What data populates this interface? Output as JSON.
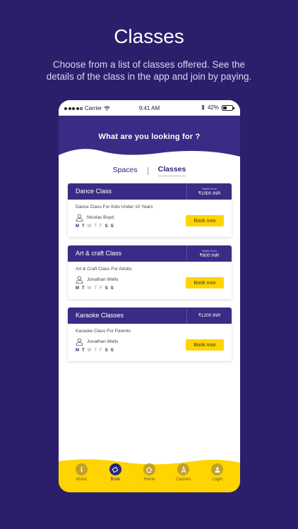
{
  "promo": {
    "title": "Classes",
    "subtitle": "Choose from a list of classes offered. See the details of the class in the app and join by paying."
  },
  "status_bar": {
    "carrier": "Carrier",
    "time": "9:41 AM",
    "battery": "42%"
  },
  "header": {
    "title": "What are you looking for ?"
  },
  "tabs": [
    {
      "label": "Spaces",
      "active": false
    },
    {
      "label": "Classes",
      "active": true
    }
  ],
  "classes": [
    {
      "title": "Dance Class",
      "price_label": "Starts From",
      "price": "₹1000 INR",
      "description": "Dance Class For Kids Under 10 Years",
      "teacher": "Nicolas Boyd",
      "days": [
        "M",
        "T",
        "W",
        "T",
        "F",
        "S",
        "S"
      ],
      "days_on": [
        true,
        true,
        false,
        false,
        false,
        true,
        true
      ],
      "book_label": "Book now"
    },
    {
      "title": "Art & craft Class",
      "price_label": "Starts From",
      "price": "₹800 INR",
      "description": "Art & Craft Class For Adults",
      "teacher": "Jonathan Wells",
      "days": [
        "M",
        "T",
        "W",
        "T",
        "F",
        "S",
        "S"
      ],
      "days_on": [
        true,
        true,
        false,
        false,
        false,
        true,
        true
      ],
      "book_label": "Book now"
    },
    {
      "title": "Karaoke Classes",
      "price_label": "",
      "price": "₹1200 INR",
      "description": "Karaoke Class For Parents",
      "teacher": "Jonathan Wells",
      "days": [
        "M",
        "T",
        "W",
        "T",
        "F",
        "S",
        "S"
      ],
      "days_on": [
        true,
        true,
        false,
        false,
        false,
        true,
        true
      ],
      "book_label": "Book now"
    }
  ],
  "nav": [
    {
      "label": "About",
      "icon": "info-icon",
      "active": false
    },
    {
      "label": "Book",
      "icon": "ticket-icon",
      "active": true
    },
    {
      "label": "Home",
      "icon": "home-icon",
      "active": false
    },
    {
      "label": "Classes",
      "icon": "classes-icon",
      "active": false
    },
    {
      "label": "Login",
      "icon": "user-icon",
      "active": false
    }
  ],
  "colors": {
    "background": "#2b1f6b",
    "header": "#392c86",
    "accent": "#ffd400",
    "nav_bar": "#ffd400"
  }
}
